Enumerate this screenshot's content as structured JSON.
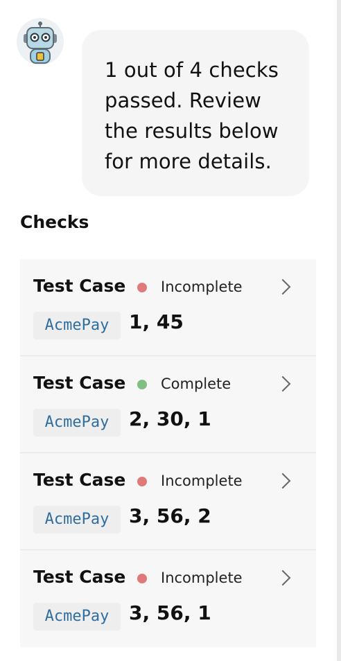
{
  "chat": {
    "message": "1 out of 4 checks passed. Review the results below for more details."
  },
  "checks_section": {
    "title": "Checks",
    "items": [
      {
        "title": "Test Case",
        "status": "Incomplete",
        "status_color": "#e07a7a",
        "tag": "AcmePay",
        "ids": "1, 45"
      },
      {
        "title": "Test Case",
        "status": "Complete",
        "status_color": "#7fbf84",
        "tag": "AcmePay",
        "ids": "2, 30, 1"
      },
      {
        "title": "Test Case",
        "status": "Incomplete",
        "status_color": "#e07a7a",
        "tag": "AcmePay",
        "ids": "3, 56, 2"
      },
      {
        "title": "Test Case",
        "status": "Incomplete",
        "status_color": "#e07a7a",
        "tag": "AcmePay",
        "ids": "3, 56, 1"
      }
    ]
  },
  "icons": {
    "avatar": "robot-avatar-icon",
    "chevron": "chevron-right-icon",
    "status": "status-dot-icon"
  }
}
